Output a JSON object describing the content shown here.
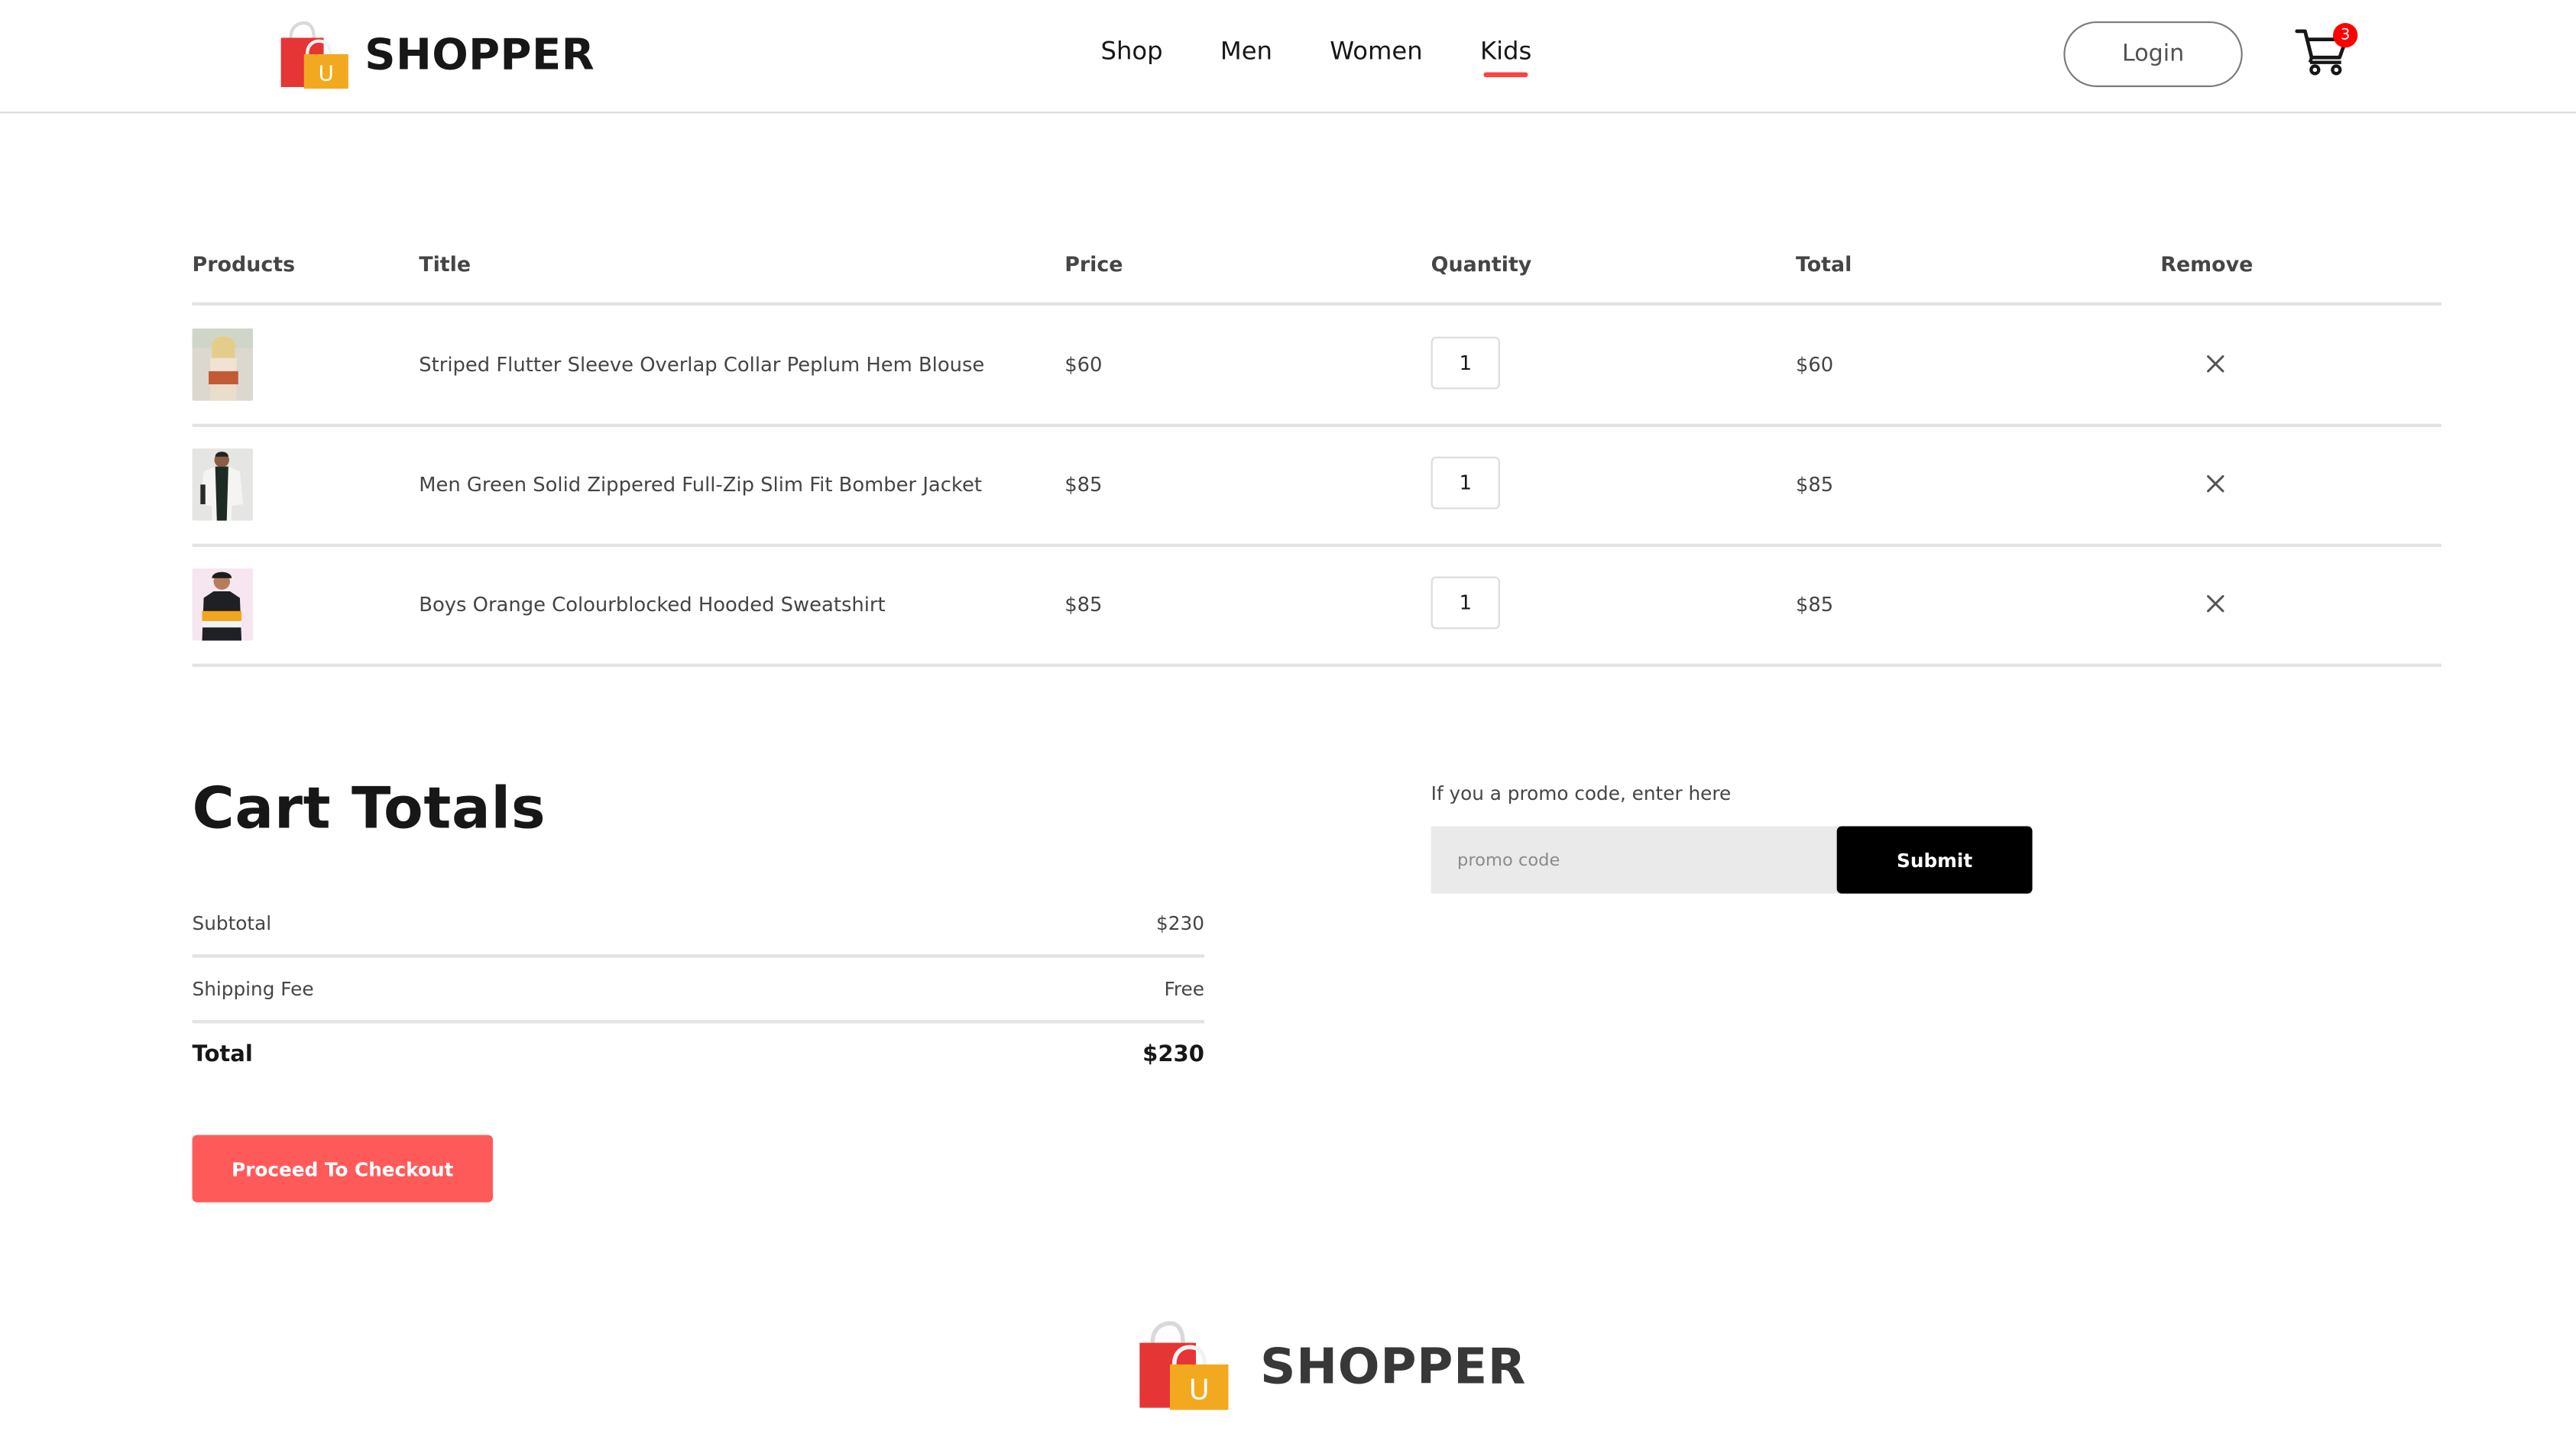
{
  "brand": {
    "name": "SHOPPER",
    "logo_icon": "shopping-bag-icon",
    "logo_letter": "U"
  },
  "nav": {
    "items": [
      {
        "label": "Shop",
        "active": false
      },
      {
        "label": "Men",
        "active": false
      },
      {
        "label": "Women",
        "active": false
      },
      {
        "label": "Kids",
        "active": true
      }
    ],
    "login_label": "Login",
    "cart_icon": "cart-icon",
    "cart_count": "3"
  },
  "cart": {
    "headers": {
      "products": "Products",
      "title": "Title",
      "price": "Price",
      "quantity": "Quantity",
      "total": "Total",
      "remove": "Remove"
    },
    "items": [
      {
        "title": "Striped Flutter Sleeve Overlap Collar Peplum Hem Blouse",
        "price": "$60",
        "quantity": "1",
        "total": "$60",
        "image": "blouse-product-image"
      },
      {
        "title": "Men Green Solid Zippered Full-Zip Slim Fit Bomber Jacket",
        "price": "$85",
        "quantity": "1",
        "total": "$85",
        "image": "jacket-product-image"
      },
      {
        "title": "Boys Orange Colourblocked Hooded Sweatshirt",
        "price": "$85",
        "quantity": "1",
        "total": "$85",
        "image": "sweatshirt-product-image"
      }
    ],
    "remove_icon": "close-icon"
  },
  "totals": {
    "heading": "Cart Totals",
    "subtotal_label": "Subtotal",
    "subtotal_value": "$230",
    "shipping_label": "Shipping Fee",
    "shipping_value": "Free",
    "total_label": "Total",
    "total_value": "$230",
    "checkout_label": "Proceed To Checkout"
  },
  "promo": {
    "label": "If you a promo code, enter here",
    "placeholder": "promo code",
    "value": "",
    "submit_label": "Submit"
  },
  "footer": {
    "brand_name": "SHOPPER"
  },
  "colors": {
    "accent": "#ff4141",
    "checkout_button": "#ff5a5a",
    "cart_badge": "#ff0000",
    "submit_button": "#000000",
    "promo_background": "#eaeaea"
  }
}
